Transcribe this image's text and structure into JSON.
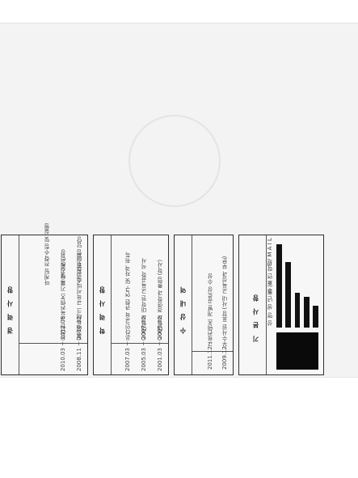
{
  "sections": [
    {
      "id": "career",
      "heading": "경 력 사 항",
      "rows": [
        {
          "period": "2008.11 ~ 2010.02",
          "desc": "(주)에듀테크 교육서비스 전문기업",
          "role": "고객지원 영업 담당"
        },
        {
          "period": "2010.03 ~ 2012.08",
          "desc": "온라인 교육컨텐츠 기획 및 운영",
          "role": "교육기획 팀장"
        },
        {
          "period": "",
          "desc": "",
          "role": "마케팅 전략수립 및 실행"
        }
      ]
    },
    {
      "id": "education",
      "heading": "학 력 사 항",
      "rows": [
        {
          "period": "2001.03 ~ 2005.02",
          "desc": "OO대학교 경영학과 졸업 (학사)"
        },
        {
          "period": "2005.03 ~ 2007.02",
          "desc": "OO대학교 대학원 교육공학 석사"
        },
        {
          "period": "2007.03 ~",
          "desc": "온라인교육 관련 연구 및 자격 취득"
        }
      ]
    },
    {
      "id": "awards",
      "heading": "수 상 내 역",
      "rows": [
        {
          "period": "2009.12",
          "desc": "우수사원 표창 (사내 교육성과 부문)"
        },
        {
          "period": "2011.12",
          "desc": "교육컨텐츠 개발 공로상 수상"
        }
      ]
    }
  ],
  "profile": {
    "heading": "기 본 사 항",
    "fields": [
      "성 명",
      "생 년 월 일",
      "주 소",
      "연 락 처",
      "E - M A I L"
    ]
  },
  "chart_data": {
    "type": "bar",
    "categories": [
      "",
      "",
      "",
      "",
      ""
    ],
    "values": [
      25,
      35,
      40,
      75,
      95
    ],
    "ylim": [
      0,
      100
    ]
  }
}
